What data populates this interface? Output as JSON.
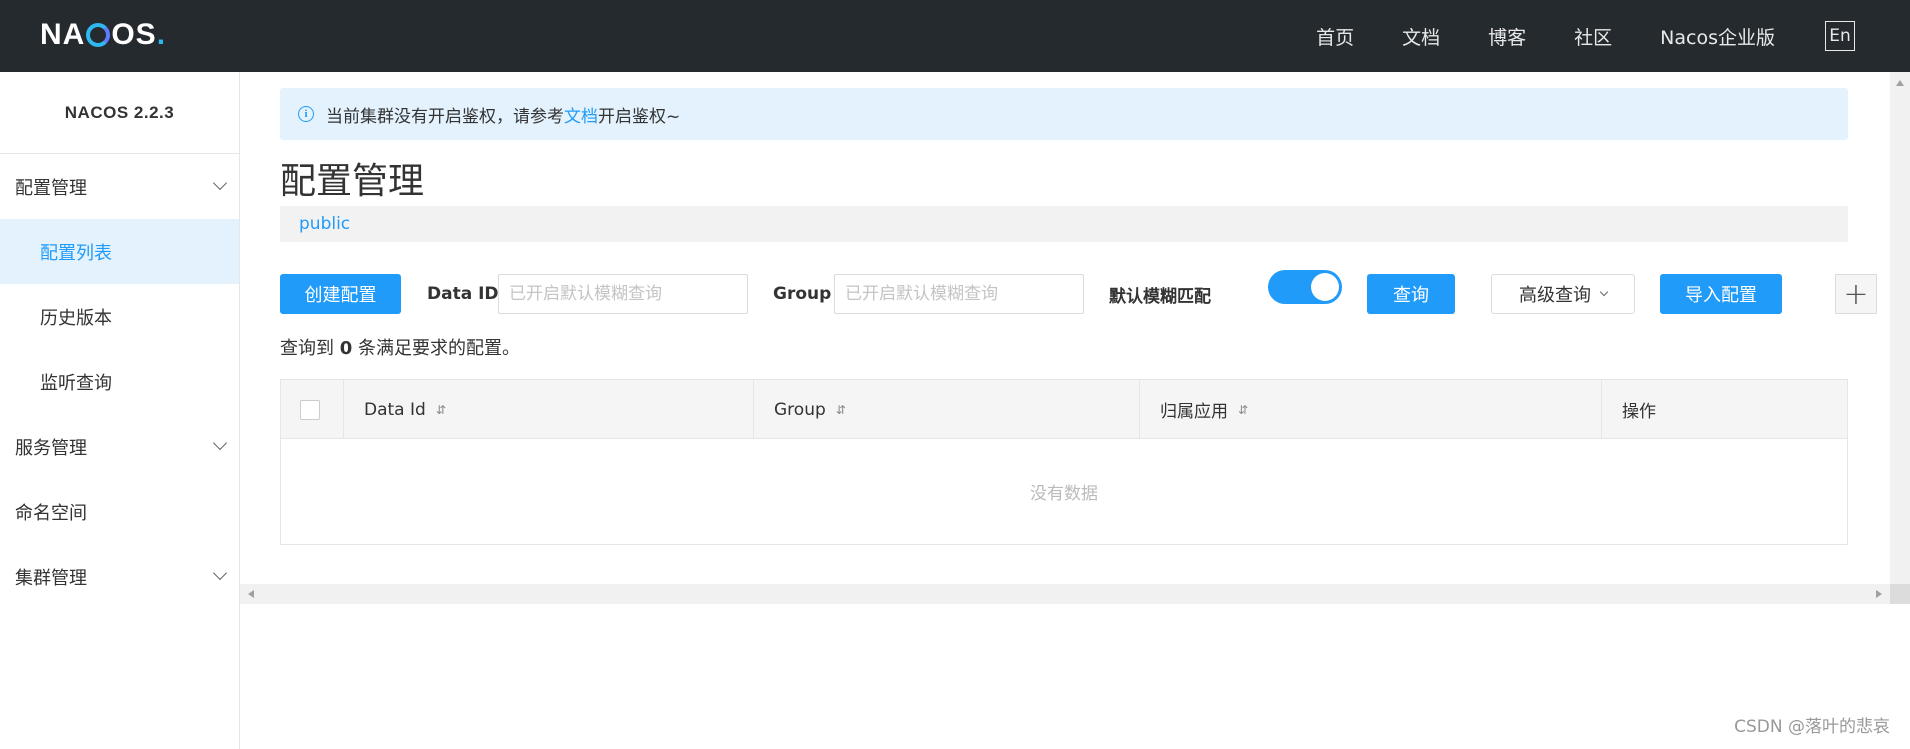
{
  "header": {
    "logo_prefix": "NA",
    "logo_suffix": "OS",
    "logo_dot": ".",
    "nav": [
      "首页",
      "文档",
      "博客",
      "社区",
      "Nacos企业版"
    ],
    "lang": "En"
  },
  "sidebar": {
    "version": "NACOS 2.2.3",
    "items": [
      {
        "label": "配置管理"
      },
      {
        "label": "配置列表"
      },
      {
        "label": "历史版本"
      },
      {
        "label": "监听查询"
      },
      {
        "label": "服务管理"
      },
      {
        "label": "命名空间"
      },
      {
        "label": "集群管理"
      }
    ]
  },
  "notice": {
    "text_before": "当前集群没有开启鉴权，请参考",
    "link": "文档",
    "text_after": "开启鉴权~"
  },
  "page": {
    "title": "配置管理",
    "namespace": "public"
  },
  "toolbar": {
    "create_label": "创建配置",
    "dataid_label": "Data ID",
    "dataid_placeholder": "已开启默认模糊查询",
    "group_label": "Group",
    "group_placeholder": "已开启默认模糊查询",
    "fuzzy_label": "默认模糊匹配",
    "fuzzy_on": true,
    "query_label": "查询",
    "advanced_label": "高级查询",
    "import_label": "导入配置",
    "plus": "+"
  },
  "result": {
    "prefix": "查询到",
    "count": "0",
    "suffix": "条满足要求的配置。"
  },
  "table": {
    "columns": [
      "Data Id",
      "Group",
      "归属应用",
      "操作"
    ],
    "sort_icon": "⇵",
    "empty_text": "没有数据"
  },
  "watermark": "CSDN @落叶的悲哀",
  "colors": {
    "accent": "#209bfa",
    "topbar": "#252a2f",
    "active_bg": "#e3f2fd"
  }
}
